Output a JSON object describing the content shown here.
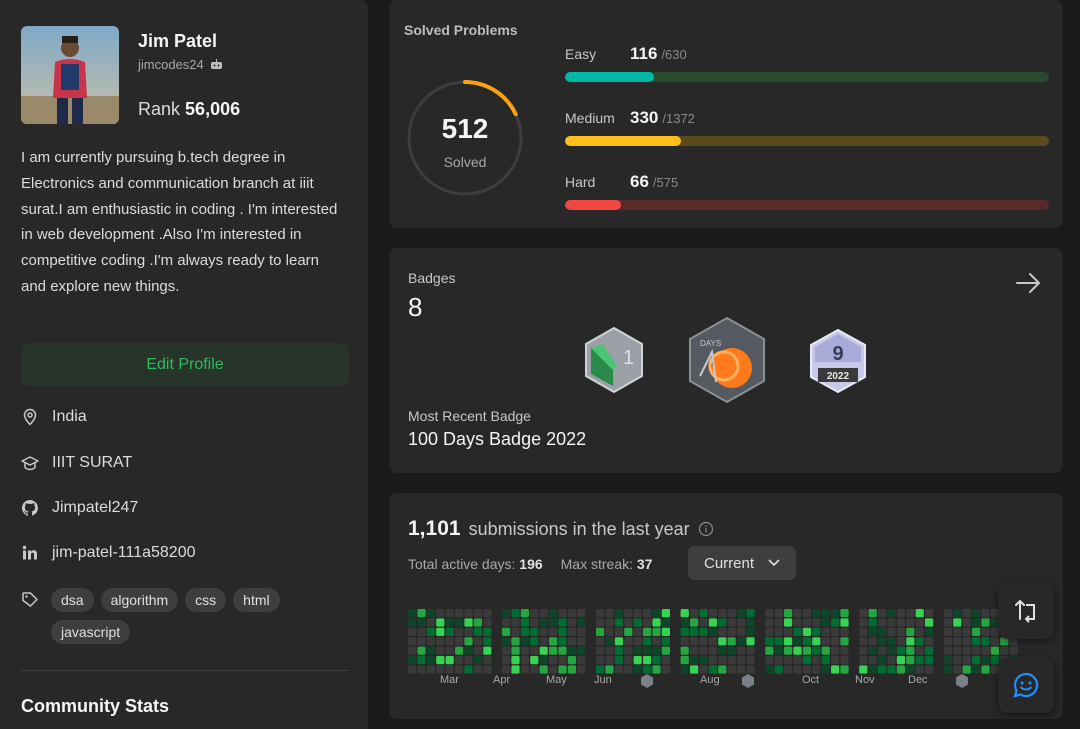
{
  "profile": {
    "name": "Jim Patel",
    "username": "jimcodes24",
    "rank_label": "Rank",
    "rank_value": "56,006",
    "bio": "I am currently pursuing b.tech degree in Electronics and communication branch at iiit surat.I am enthusiastic in coding . I'm interested in web development .Also I'm interested in competitive coding .I'm always ready to learn and explore new things.",
    "edit_button": "Edit Profile",
    "location": "India",
    "school": "IIIT SURAT",
    "github": "Jimpatel247",
    "linkedin": "jim-patel-111a58200",
    "skills": [
      "dsa",
      "algorithm",
      "css",
      "html",
      "javascript"
    ],
    "community_title": "Community Stats"
  },
  "solved": {
    "title": "Solved Problems",
    "total": "512",
    "total_label": "Solved",
    "progress_fraction": 0.18,
    "difficulties": [
      {
        "label": "Easy",
        "count": "116",
        "total": "/630",
        "fraction": 0.184,
        "color": "#00b8a3",
        "track": "#2a4a2f"
      },
      {
        "label": "Medium",
        "count": "330",
        "total": "/1372",
        "fraction": 0.24,
        "color": "#ffc01e",
        "track": "#5a4a1e"
      },
      {
        "label": "Hard",
        "count": "66",
        "total": "/575",
        "fraction": 0.115,
        "color": "#ef4743",
        "track": "#5a2a2a"
      }
    ]
  },
  "badges": {
    "title": "Badges",
    "count": "8",
    "items": [
      {
        "name": "badge-1",
        "text": "1"
      },
      {
        "name": "badge-100-days",
        "text": "DAYS"
      },
      {
        "name": "badge-2022",
        "text": "9",
        "year": "2022"
      }
    ],
    "recent_label": "Most Recent Badge",
    "recent_name": "100 Days Badge 2022"
  },
  "submissions": {
    "count": "1,101",
    "text": "submissions in the last year",
    "active_days_label": "Total active days:",
    "active_days": "196",
    "max_streak_label": "Max streak:",
    "max_streak": "37",
    "dropdown_value": "Current",
    "months": [
      "Mar",
      "Apr",
      "May",
      "Jun",
      "Aug",
      "Oct",
      "Nov",
      "Dec"
    ]
  },
  "colors": {
    "accent_green": "#2cbb5d",
    "card_bg": "#282828",
    "page_bg": "#1a1a1a",
    "ring_orange": "#ffa116"
  }
}
